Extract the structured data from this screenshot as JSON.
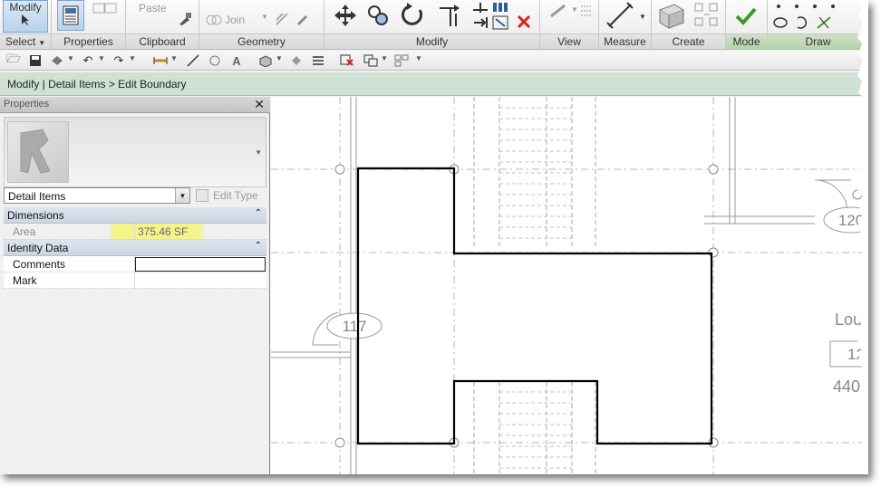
{
  "ribbon": {
    "panels": [
      {
        "id": "select",
        "label": "Select",
        "has_dropdown": true
      },
      {
        "id": "properties",
        "label": "Properties"
      },
      {
        "id": "clipboard",
        "label": "Clipboard"
      },
      {
        "id": "geometry",
        "label": "Geometry"
      },
      {
        "id": "modify",
        "label": "Modify"
      },
      {
        "id": "view",
        "label": "View"
      },
      {
        "id": "measure",
        "label": "Measure"
      },
      {
        "id": "create",
        "label": "Create"
      },
      {
        "id": "mode",
        "label": "Mode"
      },
      {
        "id": "draw",
        "label": "Draw"
      }
    ],
    "modify_tool_label": "Modify",
    "paste_label": "Paste",
    "join_label": "Join",
    "cut_label": "Cut"
  },
  "context_bar": {
    "breadcrumb": "Modify | Detail Items > Edit Boundary"
  },
  "properties_palette": {
    "title": "Properties",
    "family_selector_value": "Detail Items",
    "edit_type_label": "Edit Type",
    "groups": [
      {
        "name": "Dimensions",
        "rows": [
          {
            "key": "Area",
            "value": "375.46 SF",
            "read_only": true
          }
        ]
      },
      {
        "name": "Identity Data",
        "rows": [
          {
            "key": "Comments",
            "value": "",
            "read_only": false
          },
          {
            "key": "Mark",
            "value": "",
            "read_only": false
          }
        ]
      }
    ]
  },
  "canvas": {
    "room_tags": [
      "117",
      "120",
      "12",
      "440"
    ],
    "room_name_partial": "Lou"
  },
  "colors": {
    "context_bar_bg": "#cfe0d4",
    "highlight": "#f6f57a",
    "finish_check": "#3a9a2a",
    "cancel_x": "#d42020",
    "boundary_line": "#000000"
  },
  "icons": [
    "modify-arrow-icon",
    "properties-icon",
    "paste-icon",
    "join-icon",
    "move-icon",
    "copy-icon",
    "rotate-icon",
    "trim-icon",
    "delete-icon",
    "view-icon",
    "measure-icon",
    "create-icon",
    "finish-check-icon",
    "cancel-icon",
    "draw-tools-icon"
  ]
}
